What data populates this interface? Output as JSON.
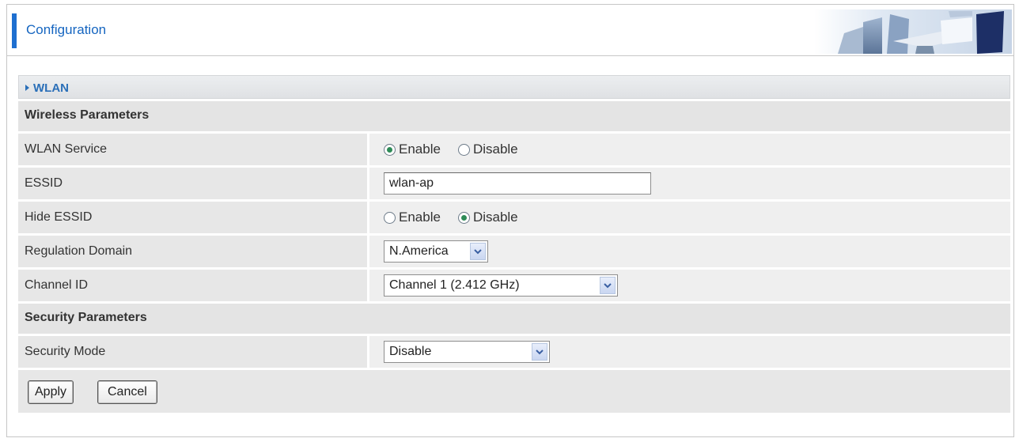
{
  "header": {
    "title": "Configuration"
  },
  "section": {
    "title": "WLAN"
  },
  "wireless_group": {
    "label": "Wireless Parameters"
  },
  "wlan_service": {
    "label": "WLAN Service",
    "options": [
      "Enable",
      "Disable"
    ],
    "selected": "Enable"
  },
  "essid": {
    "label": "ESSID",
    "value": "wlan-ap"
  },
  "hide_essid": {
    "label": "Hide ESSID",
    "options": [
      "Enable",
      "Disable"
    ],
    "selected": "Disable"
  },
  "regulation_domain": {
    "label": "Regulation Domain",
    "value": "N.America"
  },
  "channel_id": {
    "label": "Channel ID",
    "value": "Channel 1 (2.412 GHz)"
  },
  "security_group": {
    "label": "Security Parameters"
  },
  "security_mode": {
    "label": "Security Mode",
    "value": "Disable"
  },
  "buttons": {
    "apply": "Apply",
    "cancel": "Cancel"
  },
  "colors": {
    "accent": "#1e6fd0",
    "title": "#1565c0",
    "section_title": "#2a6fb8",
    "radio_checked": "#2e8b57"
  }
}
